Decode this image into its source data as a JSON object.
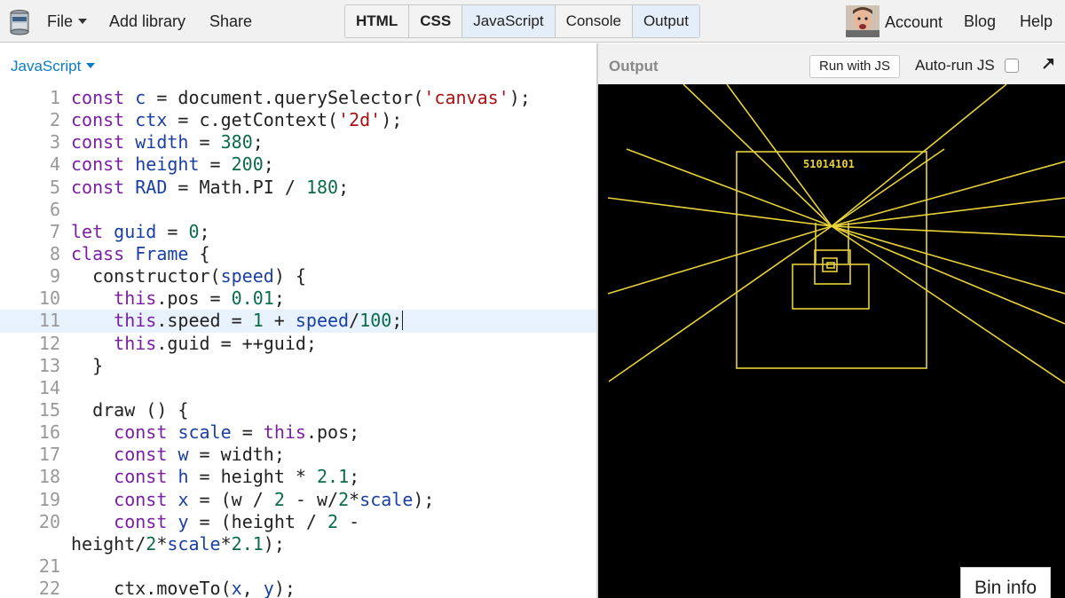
{
  "topbar": {
    "menus": [
      "File",
      "Add library",
      "Share"
    ],
    "panels": [
      {
        "label": "HTML",
        "active": false
      },
      {
        "label": "CSS",
        "active": false
      },
      {
        "label": "JavaScript",
        "active": true
      },
      {
        "label": "Console",
        "active": false
      },
      {
        "label": "Output",
        "active": true
      }
    ],
    "account": "Account",
    "blog": "Blog",
    "help": "Help"
  },
  "editor": {
    "language": "JavaScript",
    "current_line": 11,
    "lines": [
      {
        "n": "1",
        "html": "<span class=\"kw\">const</span> <span class=\"df\">c</span> = document.querySelector(<span class=\"st\">'canvas'</span>);"
      },
      {
        "n": "2",
        "html": "<span class=\"kw\">const</span> <span class=\"df\">ctx</span> = c.getContext(<span class=\"st\">'2d'</span>);"
      },
      {
        "n": "3",
        "html": "<span class=\"kw\">const</span> <span class=\"df\">width</span> = <span class=\"nm\">380</span>;"
      },
      {
        "n": "4",
        "html": "<span class=\"kw\">const</span> <span class=\"df\">height</span> = <span class=\"nm\">200</span>;"
      },
      {
        "n": "5",
        "html": "<span class=\"kw\">const</span> <span class=\"df\">RAD</span> = Math.PI / <span class=\"nm\">180</span>;"
      },
      {
        "n": "6",
        "html": ""
      },
      {
        "n": "7",
        "html": "<span class=\"kw\">let</span> <span class=\"df\">guid</span> = <span class=\"nm\">0</span>;"
      },
      {
        "n": "8",
        "html": "<span class=\"kw\">class</span> <span class=\"df\">Frame</span> {"
      },
      {
        "n": "9",
        "html": "  constructor(<span class=\"df\">speed</span>) {"
      },
      {
        "n": "10",
        "html": "    <span class=\"kw\">this</span>.pos = <span class=\"nm\">0.01</span>;"
      },
      {
        "n": "11",
        "html": "    <span class=\"kw\">this</span>.speed = <span class=\"nm\">1</span> + <span class=\"df\">speed</span>/<span class=\"nm\">100</span>;<span class=\"cursor\"></span>"
      },
      {
        "n": "12",
        "html": "    <span class=\"kw\">this</span>.guid = ++guid;"
      },
      {
        "n": "13",
        "html": "  }"
      },
      {
        "n": "14",
        "html": ""
      },
      {
        "n": "15",
        "html": "  draw () {"
      },
      {
        "n": "16",
        "html": "    <span class=\"kw\">const</span> <span class=\"df\">scale</span> = <span class=\"kw\">this</span>.pos;"
      },
      {
        "n": "17",
        "html": "    <span class=\"kw\">const</span> <span class=\"df\">w</span> = width;"
      },
      {
        "n": "18",
        "html": "    <span class=\"kw\">const</span> <span class=\"df\">h</span> = height * <span class=\"nm\">2.1</span>;"
      },
      {
        "n": "19",
        "html": "    <span class=\"kw\">const</span> <span class=\"df\">x</span> = (w / <span class=\"nm\">2</span> - w/<span class=\"nm\">2</span>*<span class=\"df\">scale</span>);"
      },
      {
        "n": "20",
        "html": "    <span class=\"kw\">const</span> <span class=\"df\">y</span> = (height / <span class=\"nm\">2</span> -\nheight/<span class=\"nm\">2</span>*<span class=\"df\">scale</span>*<span class=\"nm\">2.1</span>);",
        "wrap": true
      },
      {
        "n": "21",
        "html": ""
      },
      {
        "n": "22",
        "html": "    ctx.moveTo(<span class=\"df\">x</span>, <span class=\"df\">y</span>);"
      }
    ]
  },
  "output": {
    "title": "Output",
    "run_button": "Run with JS",
    "autorun_label": "Auto-run JS",
    "autorun_checked": false,
    "score": "51014101",
    "line_color": "#e8d23a",
    "bin_info": "Bin info"
  }
}
